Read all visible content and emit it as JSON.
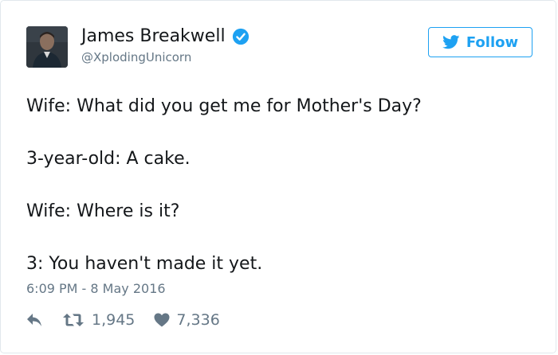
{
  "tweet": {
    "author": {
      "name": "James Breakwell",
      "handle": "@XplodingUnicorn",
      "verified": true
    },
    "follow_label": "Follow",
    "lines": [
      "Wife: What did you get me for Mother's Day?",
      "3-year-old: A cake.",
      "Wife: Where is it?",
      "3: You haven't made it yet."
    ],
    "timestamp": "6:09 PM - 8 May 2016",
    "retweets": "1,945",
    "likes": "7,336"
  },
  "colors": {
    "accent": "#1da1f2",
    "text": "#14171a",
    "muted": "#657786",
    "border": "#e1e8ed"
  },
  "icons": [
    "verified-badge-icon",
    "twitter-bird-icon",
    "reply-icon",
    "retweet-icon",
    "heart-icon"
  ]
}
